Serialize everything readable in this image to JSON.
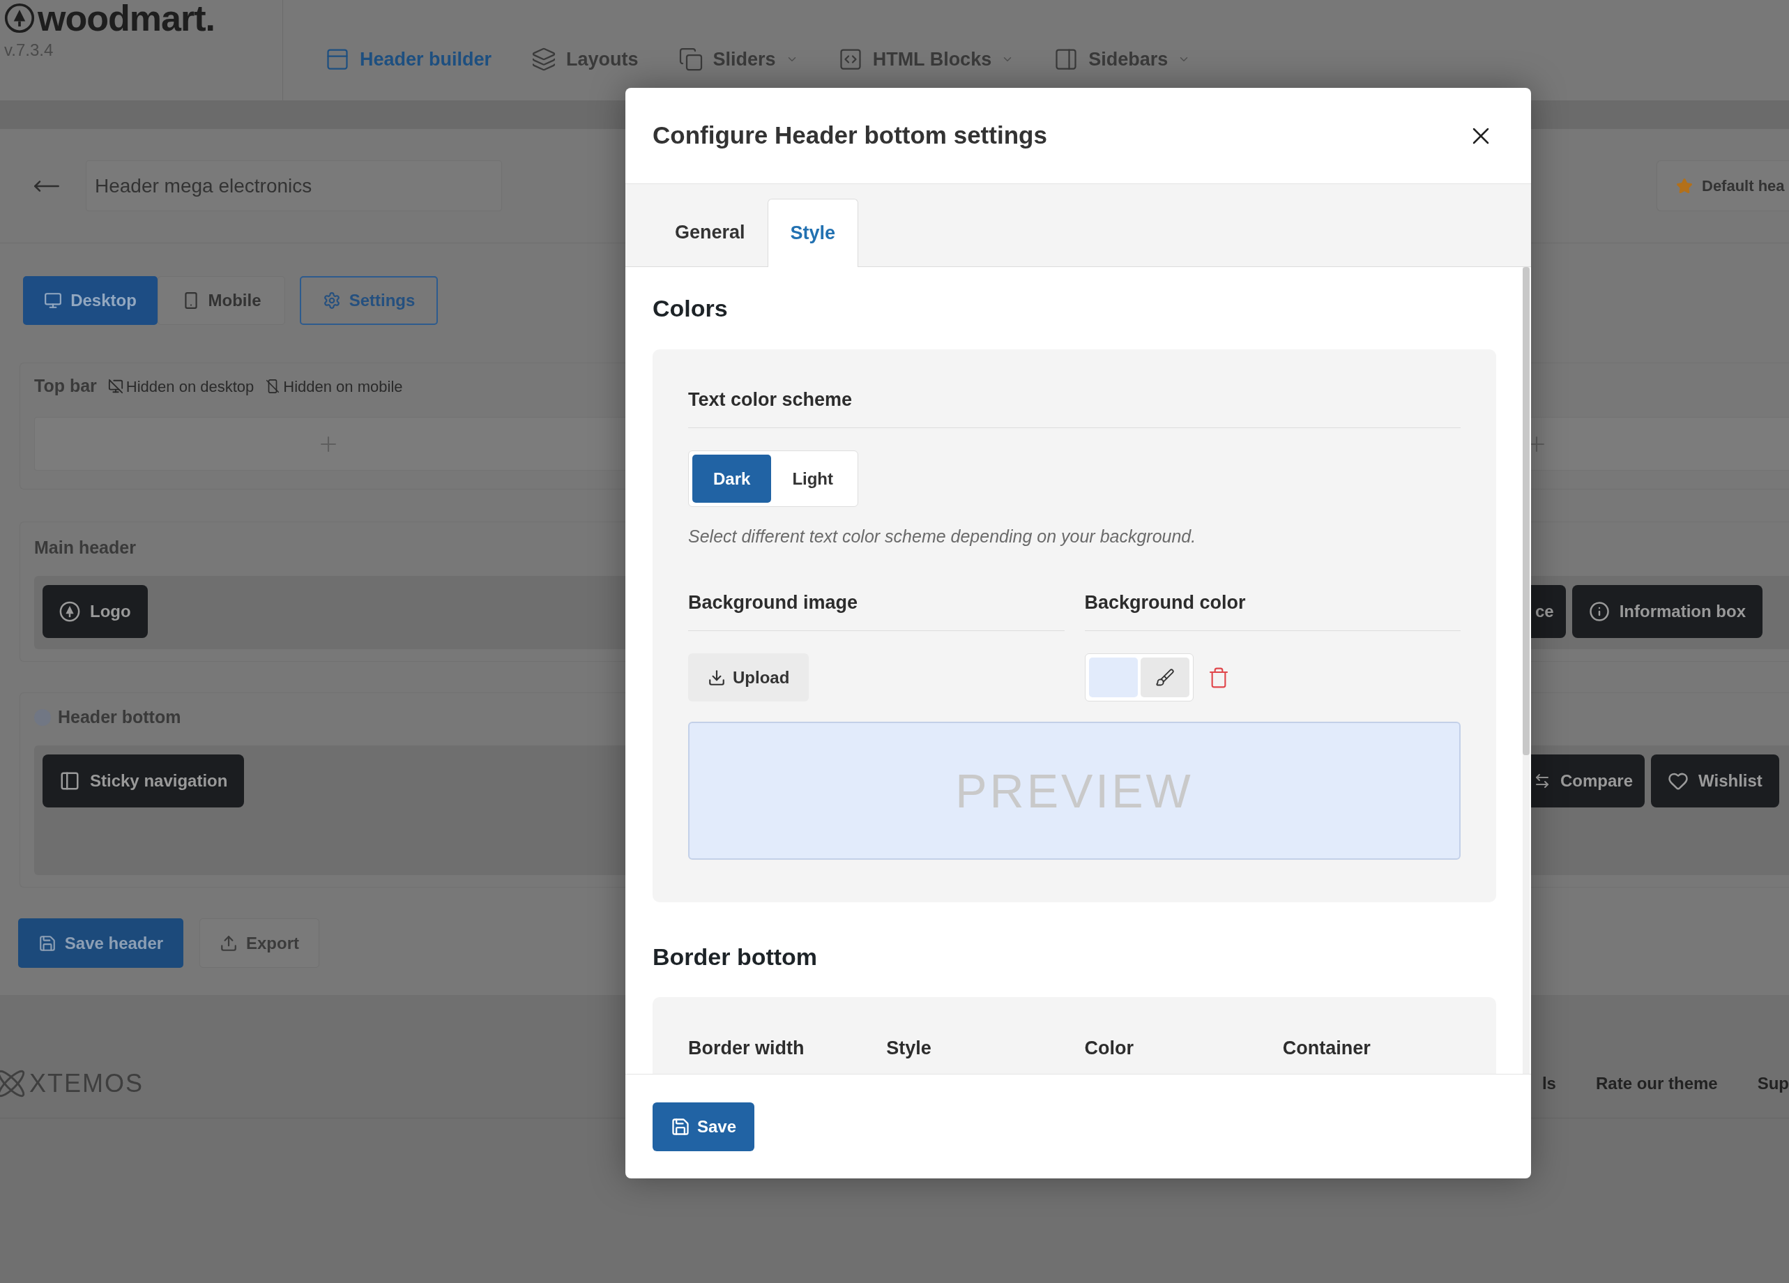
{
  "brand": {
    "logo": "woodmart.",
    "version": "v.7.3.4"
  },
  "nav": [
    {
      "label": "Header builder",
      "selected": true,
      "dropdown": false
    },
    {
      "label": "Layouts",
      "selected": false,
      "dropdown": false
    },
    {
      "label": "Sliders",
      "selected": false,
      "dropdown": true
    },
    {
      "label": "HTML Blocks",
      "selected": false,
      "dropdown": true
    },
    {
      "label": "Sidebars",
      "selected": false,
      "dropdown": true
    }
  ],
  "header_name": {
    "value": "Header mega electronics"
  },
  "default_button": {
    "label": "Default hea"
  },
  "device_tabs": [
    {
      "label": "Desktop",
      "selected": true
    },
    {
      "label": "Mobile",
      "selected": false
    }
  ],
  "settings_button": {
    "label": "Settings"
  },
  "rows": [
    {
      "kind": "top",
      "label": "Top bar",
      "hints": [
        "Hidden on desktop",
        "Hidden on mobile"
      ]
    },
    {
      "kind": "main",
      "label": "Main header",
      "left": [
        "Logo"
      ],
      "right": [
        "ce",
        "Information box"
      ]
    },
    {
      "kind": "bottom",
      "label": "Header bottom",
      "color": "#717784",
      "left": [
        "Sticky navigation"
      ],
      "right": [
        "Compare",
        "Wishlist"
      ]
    }
  ],
  "actions": [
    {
      "kind": "primary",
      "label": "Save header"
    },
    {
      "kind": "secondary",
      "label": "Export"
    }
  ],
  "footer": {
    "brand": "XTEMOS",
    "links": [
      "ls",
      "Rate our theme",
      "Sup"
    ]
  },
  "modal": {
    "title": "Configure Header bottom settings",
    "tabs": [
      {
        "label": "General",
        "selected": false
      },
      {
        "label": "Style",
        "selected": true
      }
    ],
    "colors": {
      "title": "Colors",
      "text_scheme": {
        "label": "Text color scheme",
        "options": [
          {
            "label": "Dark",
            "selected": true
          },
          {
            "label": "Light",
            "selected": false
          }
        ],
        "description": "Select different text color scheme depending on your background."
      },
      "background_image": {
        "label": "Background image",
        "button": "Upload"
      },
      "background_color": {
        "label": "Background color",
        "color": "#e2ebfb"
      },
      "preview": "PREVIEW"
    },
    "border": {
      "title": "Border bottom",
      "columns": [
        "Border width",
        "Style",
        "Color",
        "Container"
      ]
    },
    "save": "Save"
  }
}
